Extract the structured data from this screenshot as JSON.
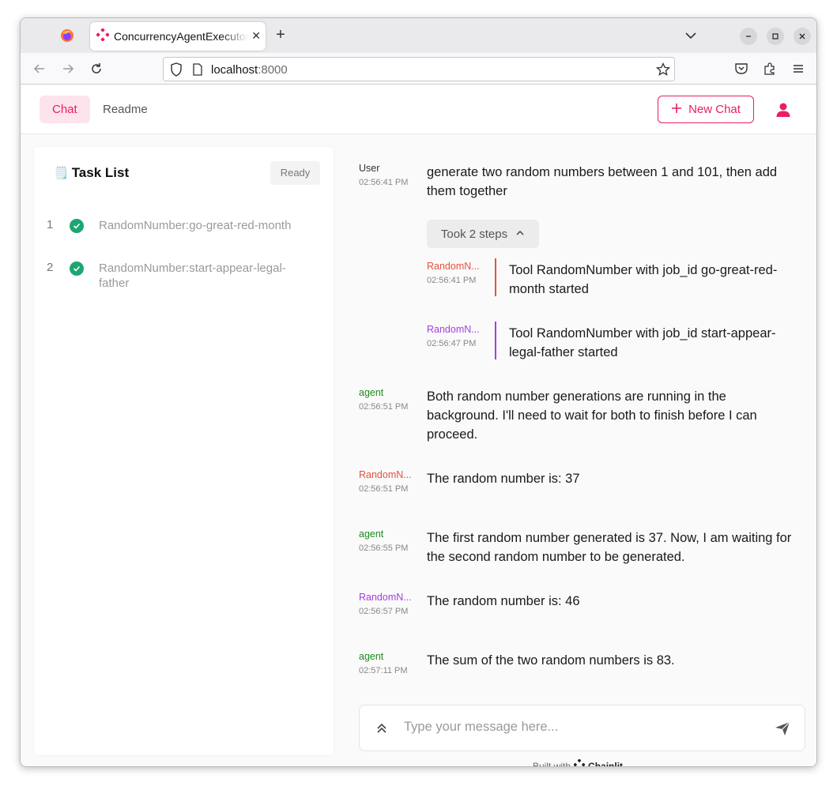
{
  "browser": {
    "tab_title": "ConcurrencyAgentExecutor",
    "url_host": "localhost",
    "url_port": ":8000"
  },
  "header": {
    "tabs": [
      {
        "label": "Chat"
      },
      {
        "label": "Readme"
      }
    ],
    "new_chat_label": "New Chat"
  },
  "tasklist": {
    "icon": "🗒️",
    "title": "Task List",
    "status": "Ready",
    "items": [
      {
        "num": "1",
        "label": "RandomNumber:go-great-red-month"
      },
      {
        "num": "2",
        "label": "RandomNumber:start-appear-legal-father"
      }
    ]
  },
  "colors": {
    "accent": "#e91e63",
    "agent": "#1e8a1e",
    "tool1": "#e5533d",
    "tool2": "#a33fe0",
    "done": "#1ea672"
  },
  "messages": {
    "m1": {
      "author": "User",
      "time": "02:56:41 PM",
      "text": "generate two random numbers between 1 and 101, then add them together"
    },
    "steps_label": "Took 2 steps",
    "s1": {
      "author": "RandomN...",
      "time": "02:56:41 PM",
      "text": "Tool RandomNumber with job_id go-great-red-month started"
    },
    "s2": {
      "author": "RandomN...",
      "time": "02:56:47 PM",
      "text": "Tool RandomNumber with job_id start-appear-legal-father started"
    },
    "m2": {
      "author": "agent",
      "time": "02:56:51 PM",
      "text": "Both random number generations are running in the background. I'll need to wait for both to finish before I can proceed."
    },
    "m3": {
      "author": "RandomN...",
      "time": "02:56:51 PM",
      "text": "The random number is: 37"
    },
    "m4": {
      "author": "agent",
      "time": "02:56:55 PM",
      "text": "The first random number generated is 37. Now, I am waiting for the second random number to be generated."
    },
    "m5": {
      "author": "RandomN...",
      "time": "02:56:57 PM",
      "text": "The random number is: 46"
    },
    "m6": {
      "author": "agent",
      "time": "02:57:11 PM",
      "text": "The sum of the two random numbers is 83."
    }
  },
  "composer": {
    "placeholder": "Type your message here..."
  },
  "footer": {
    "built_with": "Built with",
    "brand": "Chainlit"
  }
}
